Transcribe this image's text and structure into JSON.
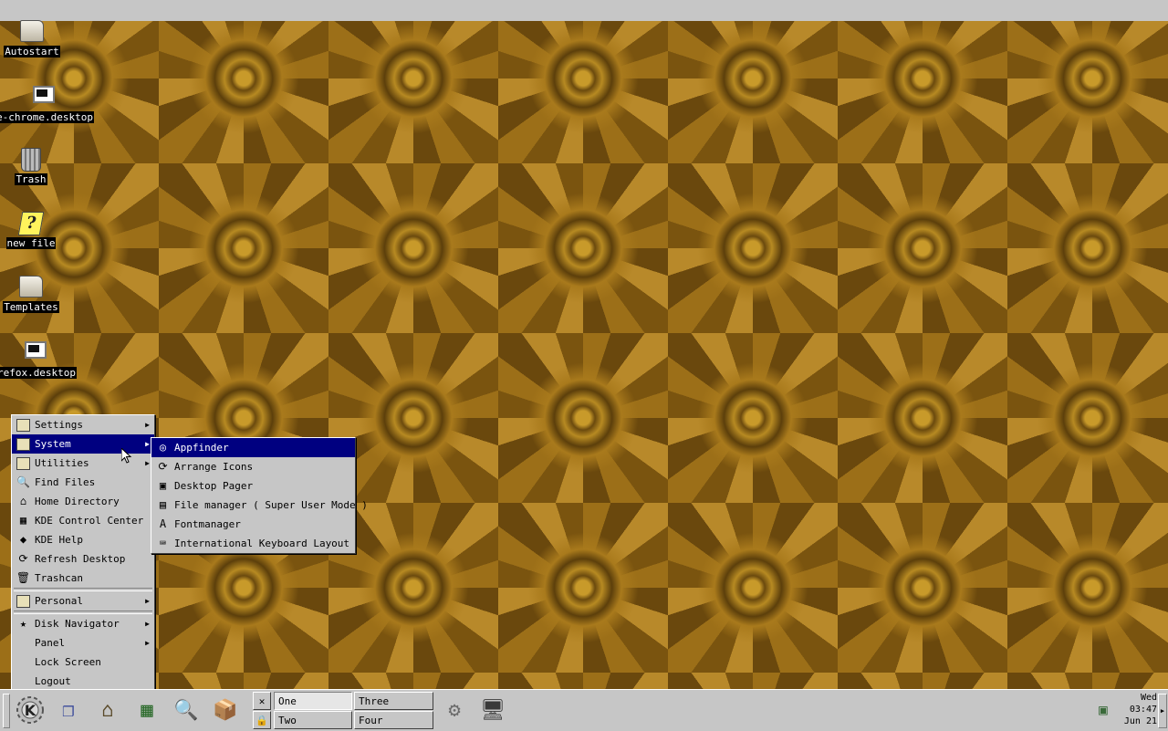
{
  "desktop": {
    "icons": [
      {
        "label": "Autostart",
        "icon": "folder-icon"
      },
      {
        "label": "e-chrome.desktop",
        "icon": "terminal-icon"
      },
      {
        "label": "Trash",
        "icon": "trash-icon"
      },
      {
        "label": "new file",
        "icon": "unknown-file-icon"
      },
      {
        "label": "Templates",
        "icon": "folder-icon"
      },
      {
        "label": "refox.desktop",
        "icon": "terminal-icon"
      }
    ]
  },
  "start_menu": {
    "items": [
      {
        "label": "Settings",
        "icon": "settings-box-icon",
        "submenu": true
      },
      {
        "label": "System",
        "icon": "system-box-icon",
        "submenu": true,
        "highlighted": true
      },
      {
        "label": "Utilities",
        "icon": "utilities-box-icon",
        "submenu": true
      },
      {
        "label": "Find Files",
        "icon": "find-files-icon"
      },
      {
        "label": "Home Directory",
        "icon": "home-icon"
      },
      {
        "label": "KDE Control Center",
        "icon": "control-center-icon"
      },
      {
        "label": "KDE Help",
        "icon": "help-icon"
      },
      {
        "label": "Refresh Desktop",
        "icon": "refresh-icon"
      },
      {
        "label": "Trashcan",
        "icon": "trash-icon"
      },
      {
        "label": "Personal",
        "icon": "personal-box-icon",
        "submenu": true
      },
      {
        "label": "Disk Navigator",
        "icon": "disk-navigator-icon",
        "submenu": true
      },
      {
        "label": "Panel",
        "submenu": true
      },
      {
        "label": "Lock Screen"
      },
      {
        "label": "Logout"
      }
    ]
  },
  "system_submenu": {
    "items": [
      {
        "label": "Appfinder",
        "icon": "appfinder-icon",
        "highlighted": true
      },
      {
        "label": "Arrange Icons",
        "icon": "arrange-icon"
      },
      {
        "label": "Desktop Pager",
        "icon": "pager-icon"
      },
      {
        "label": "File manager ( Super User Mode )",
        "icon": "file-manager-icon"
      },
      {
        "label": "Fontmanager",
        "icon": "font-icon"
      },
      {
        "label": "International Keyboard Layout",
        "icon": "keyboard-icon"
      }
    ]
  },
  "taskbar": {
    "pager": {
      "desktops": [
        "One",
        "Two",
        "Three",
        "Four"
      ],
      "active": "One"
    },
    "clock": {
      "day": "Wed",
      "time": "03:47",
      "date": "Jun 21"
    }
  },
  "colors": {
    "highlight": "#000080",
    "panel": "#c6c6c6"
  }
}
